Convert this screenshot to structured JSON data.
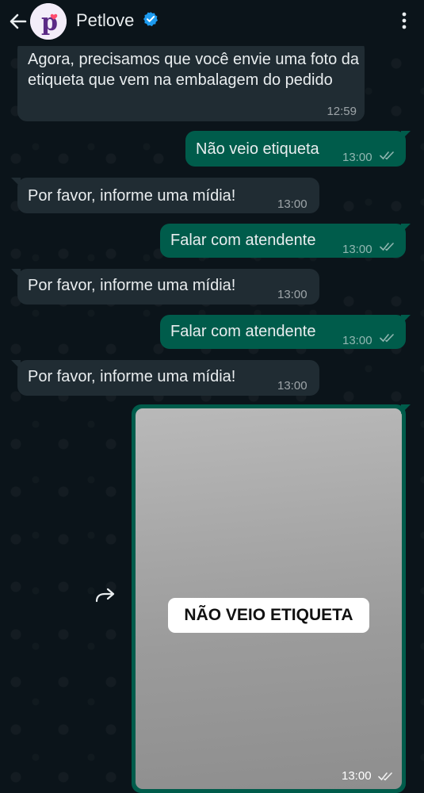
{
  "header": {
    "contact_name": "Petlove",
    "avatar_letter": "p"
  },
  "messages": [
    {
      "direction": "incoming",
      "text": "Agora, precisamos que você envie uma foto da etiqueta que vem na embalagem do pedido",
      "time": "12:59"
    },
    {
      "direction": "outgoing",
      "text": "Não veio etiqueta",
      "time": "13:00",
      "status": "read"
    },
    {
      "direction": "incoming",
      "text": "Por favor, informe uma mídia!",
      "time": "13:00"
    },
    {
      "direction": "outgoing",
      "text": "Falar com atendente",
      "time": "13:00",
      "status": "read"
    },
    {
      "direction": "incoming",
      "text": "Por favor, informe uma mídia!",
      "time": "13:00"
    },
    {
      "direction": "outgoing",
      "text": "Falar com atendente",
      "time": "13:00",
      "status": "read"
    },
    {
      "direction": "incoming",
      "text": "Por favor, informe uma mídia!",
      "time": "13:00"
    },
    {
      "direction": "outgoing",
      "type": "image",
      "image_text": "NÃO VEIO ETIQUETA",
      "time": "13:00",
      "status": "read"
    }
  ],
  "colors": {
    "background": "#0b141a",
    "incoming_bubble": "#202c33",
    "outgoing_bubble": "#005c4b",
    "brand_purple": "#5b2a86",
    "brand_heart": "#ff4b6e",
    "verified_blue": "#1d9bf0"
  },
  "icons": [
    "back-arrow-icon",
    "verified-badge-icon",
    "more-options-icon",
    "double-check-icon",
    "forward-icon"
  ]
}
